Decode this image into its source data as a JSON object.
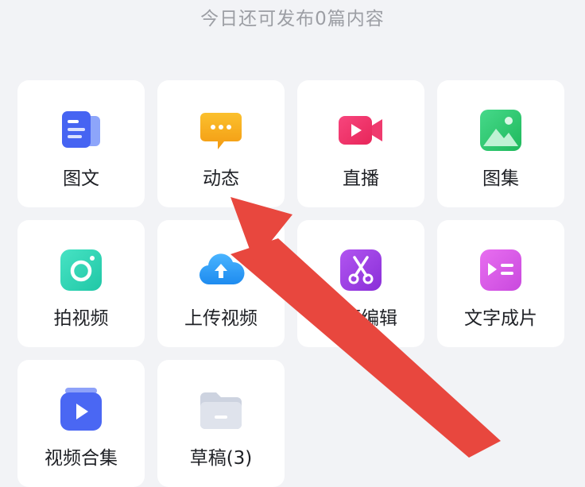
{
  "status_text": "今日还可发布0篇内容",
  "tiles": [
    {
      "label": "图文",
      "icon": "article-icon",
      "color": "#4a6cf7"
    },
    {
      "label": "动态",
      "icon": "chat-bubble-icon",
      "color": "#f7a51c"
    },
    {
      "label": "直播",
      "icon": "live-video-icon",
      "color": "#f0366b"
    },
    {
      "label": "图集",
      "icon": "gallery-icon",
      "color": "#2fc76a"
    },
    {
      "label": "拍视频",
      "icon": "camera-icon",
      "color": "#2fd6b7"
    },
    {
      "label": "上传视频",
      "icon": "cloud-upload-icon",
      "color": "#2d9cf7"
    },
    {
      "label": "视频编辑",
      "icon": "scissors-icon",
      "color": "#9b3fe0"
    },
    {
      "label": "文字成片",
      "icon": "text-to-video-icon",
      "color": "#d65be3"
    },
    {
      "label": "视频合集",
      "icon": "video-collection-icon",
      "color": "#4a6cf7"
    },
    {
      "label": "草稿(3)",
      "icon": "folder-icon",
      "color": "#c4cad8"
    }
  ],
  "annotation": {
    "type": "arrow",
    "color": "#e8473e",
    "points_to": "动态"
  }
}
